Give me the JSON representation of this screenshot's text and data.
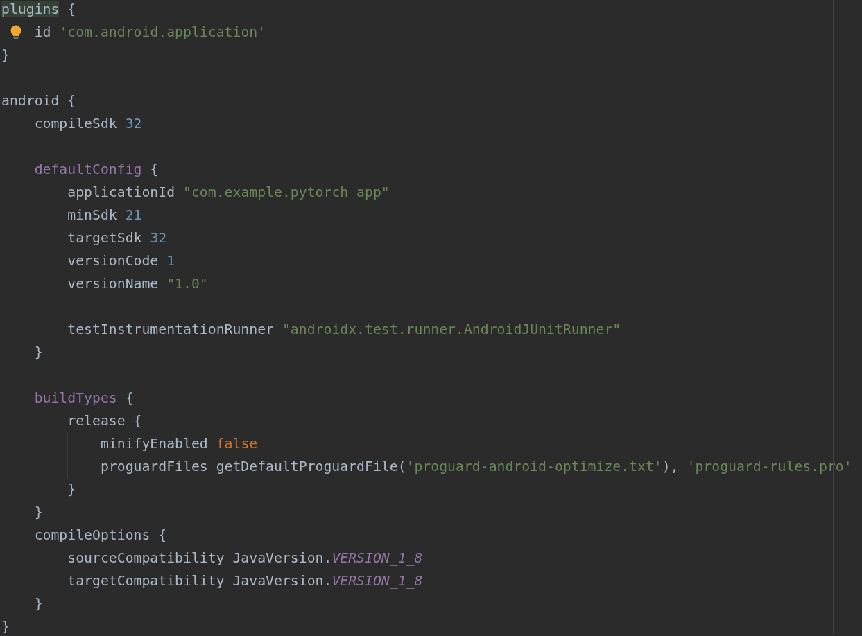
{
  "editor": {
    "lines": [
      {
        "kind": "code",
        "hint": false,
        "tokens": [
          {
            "kind": "match",
            "text": "plugins"
          },
          {
            "kind": "plain",
            "text": " {"
          }
        ]
      },
      {
        "kind": "code",
        "hint": true,
        "tokens": [
          {
            "kind": "plain",
            "text": "    id "
          },
          {
            "kind": "string",
            "text": "'com.android.application'"
          }
        ]
      },
      {
        "kind": "code",
        "hint": false,
        "tokens": [
          {
            "kind": "plain",
            "text": "}"
          }
        ]
      },
      {
        "kind": "blank"
      },
      {
        "kind": "code",
        "hint": false,
        "tokens": [
          {
            "kind": "plain",
            "text": "android {"
          }
        ]
      },
      {
        "kind": "code",
        "hint": false,
        "tokens": [
          {
            "kind": "plain",
            "text": "    compileSdk "
          },
          {
            "kind": "number",
            "text": "32"
          }
        ]
      },
      {
        "kind": "blank"
      },
      {
        "kind": "code",
        "hint": false,
        "tokens": [
          {
            "kind": "keyword",
            "text": "    defaultConfig"
          },
          {
            "kind": "plain",
            "text": " {"
          }
        ]
      },
      {
        "kind": "code",
        "hint": false,
        "tokens": [
          {
            "kind": "plain",
            "text": "        applicationId "
          },
          {
            "kind": "string",
            "text": "\"com.example.pytorch_app\""
          }
        ]
      },
      {
        "kind": "code",
        "hint": false,
        "tokens": [
          {
            "kind": "plain",
            "text": "        minSdk "
          },
          {
            "kind": "number",
            "text": "21"
          }
        ]
      },
      {
        "kind": "code",
        "hint": false,
        "tokens": [
          {
            "kind": "plain",
            "text": "        targetSdk "
          },
          {
            "kind": "number",
            "text": "32"
          }
        ]
      },
      {
        "kind": "code",
        "hint": false,
        "tokens": [
          {
            "kind": "plain",
            "text": "        versionCode "
          },
          {
            "kind": "number",
            "text": "1"
          }
        ]
      },
      {
        "kind": "code",
        "hint": false,
        "tokens": [
          {
            "kind": "plain",
            "text": "        versionName "
          },
          {
            "kind": "string",
            "text": "\"1.0\""
          }
        ]
      },
      {
        "kind": "blank"
      },
      {
        "kind": "code",
        "hint": false,
        "tokens": [
          {
            "kind": "plain",
            "text": "        testInstrumentationRunner "
          },
          {
            "kind": "string",
            "text": "\"androidx.test.runner.AndroidJUnitRunner\""
          }
        ]
      },
      {
        "kind": "code",
        "hint": false,
        "tokens": [
          {
            "kind": "plain",
            "text": "    }"
          }
        ]
      },
      {
        "kind": "blank"
      },
      {
        "kind": "code",
        "hint": false,
        "tokens": [
          {
            "kind": "keyword",
            "text": "    buildTypes"
          },
          {
            "kind": "plain",
            "text": " {"
          }
        ]
      },
      {
        "kind": "code",
        "hint": false,
        "tokens": [
          {
            "kind": "plain",
            "text": "        release {"
          }
        ]
      },
      {
        "kind": "code",
        "hint": false,
        "tokens": [
          {
            "kind": "plain",
            "text": "            minifyEnabled "
          },
          {
            "kind": "bool",
            "text": "false"
          }
        ]
      },
      {
        "kind": "code",
        "hint": false,
        "tokens": [
          {
            "kind": "plain",
            "text": "            proguardFiles getDefaultProguardFile("
          },
          {
            "kind": "string",
            "text": "'proguard-android-optimize.txt'"
          },
          {
            "kind": "plain",
            "text": "), "
          },
          {
            "kind": "string",
            "text": "'proguard-rules.pro'"
          }
        ]
      },
      {
        "kind": "code",
        "hint": false,
        "tokens": [
          {
            "kind": "plain",
            "text": "        }"
          }
        ]
      },
      {
        "kind": "code",
        "hint": false,
        "tokens": [
          {
            "kind": "plain",
            "text": "    }"
          }
        ]
      },
      {
        "kind": "code",
        "hint": false,
        "tokens": [
          {
            "kind": "plain",
            "text": "    compileOptions {"
          }
        ]
      },
      {
        "kind": "code",
        "hint": false,
        "tokens": [
          {
            "kind": "plain",
            "text": "        sourceCompatibility JavaVersion."
          },
          {
            "kind": "constant",
            "text": "VERSION_1_8"
          }
        ]
      },
      {
        "kind": "code",
        "hint": false,
        "tokens": [
          {
            "kind": "plain",
            "text": "        targetCompatibility JavaVersion."
          },
          {
            "kind": "constant",
            "text": "VERSION_1_8"
          }
        ]
      },
      {
        "kind": "code",
        "hint": false,
        "tokens": [
          {
            "kind": "plain",
            "text": "    }"
          }
        ]
      },
      {
        "kind": "code",
        "hint": false,
        "tokens": [
          {
            "kind": "plain",
            "text": "}"
          }
        ]
      }
    ]
  }
}
